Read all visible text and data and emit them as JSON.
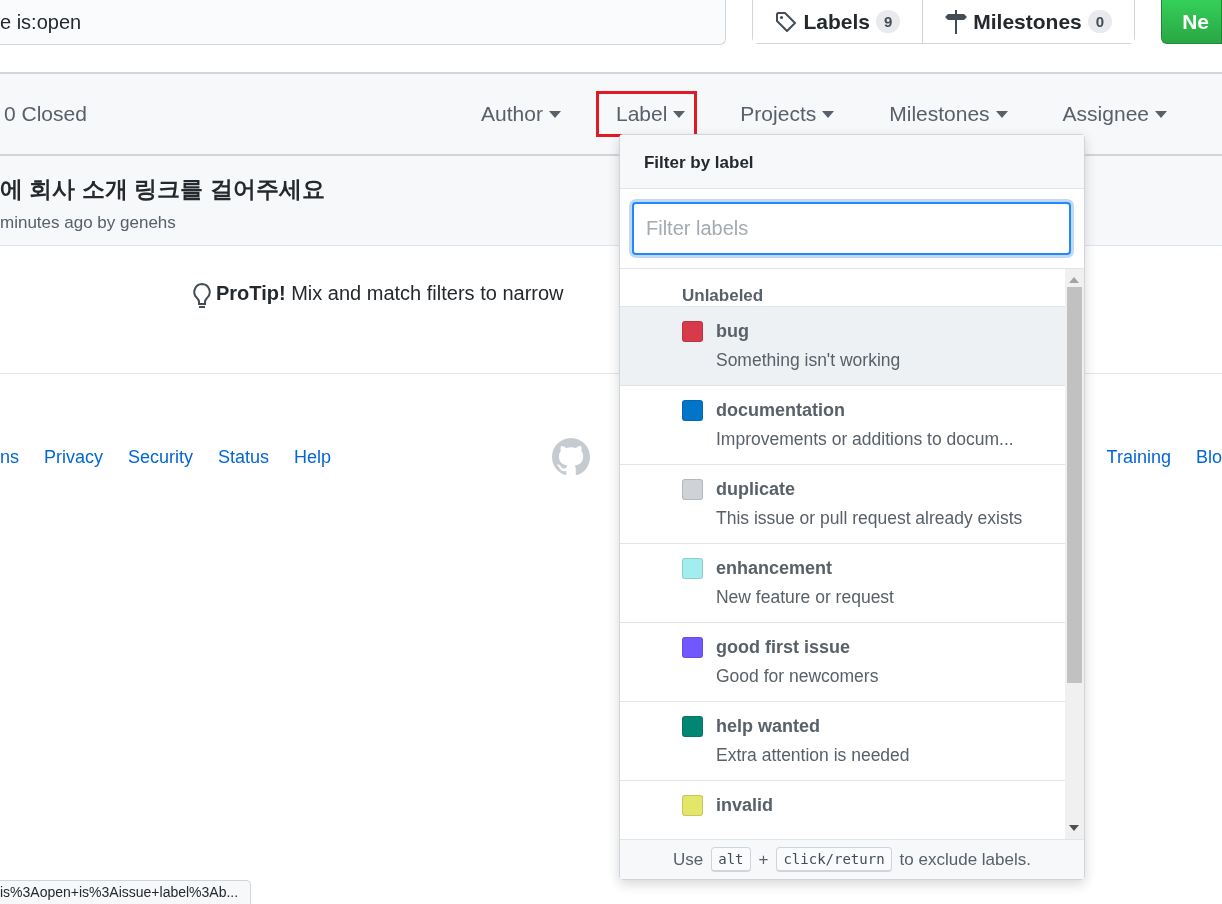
{
  "search": {
    "value": "e is:open"
  },
  "nav_buttons": [
    {
      "kind": "tag",
      "label": "Labels",
      "count": "9"
    },
    {
      "kind": "signpost",
      "label": "Milestones",
      "count": "0"
    }
  ],
  "new_button": {
    "label": "Ne"
  },
  "issues_header": {
    "closed": "0 Closed",
    "filters": [
      {
        "label": "Author",
        "selected": false
      },
      {
        "label": "Label",
        "selected": true
      },
      {
        "label": "Projects",
        "selected": false
      },
      {
        "label": "Milestones",
        "selected": false
      },
      {
        "label": "Assignee",
        "selected": false
      }
    ]
  },
  "issue": {
    "title": "에 회사 소개 링크를 걸어주세요",
    "meta": "minutes ago by genehs"
  },
  "protip": "**ProTip!** Mix and match filters to narrow",
  "footer": {
    "left_links": [
      "ns",
      "Privacy",
      "Security",
      "Status",
      "Help"
    ],
    "right_links": [
      "Training",
      "Blo"
    ]
  },
  "status_url": "is%3Aopen+is%3Aissue+label%3Ab...",
  "label_menu": {
    "title": "Filter by label",
    "placeholder": "Filter labels",
    "unlabeled": "Unlabeled",
    "labels": [
      {
        "name": "bug",
        "description": "Something isn't working",
        "color": "#d73a4a",
        "highlighted": true
      },
      {
        "name": "documentation",
        "description": "Improvements or additions to docum...",
        "color": "#0075ca",
        "highlighted": false
      },
      {
        "name": "duplicate",
        "description": "This issue or pull request already exists",
        "color": "#cfd3d7",
        "highlighted": false
      },
      {
        "name": "enhancement",
        "description": "New feature or request",
        "color": "#a2eeef",
        "highlighted": false
      },
      {
        "name": "good first issue",
        "description": "Good for newcomers",
        "color": "#7057ff",
        "highlighted": false
      },
      {
        "name": "help wanted",
        "description": "Extra attention is needed",
        "color": "#008672",
        "highlighted": false
      },
      {
        "name": "invalid",
        "color": "#e4e669",
        "highlighted": false
      }
    ],
    "footer": {
      "before": "Use",
      "key1": "alt",
      "plus": "+",
      "key2": "click/return",
      "after": "to exclude labels."
    }
  }
}
